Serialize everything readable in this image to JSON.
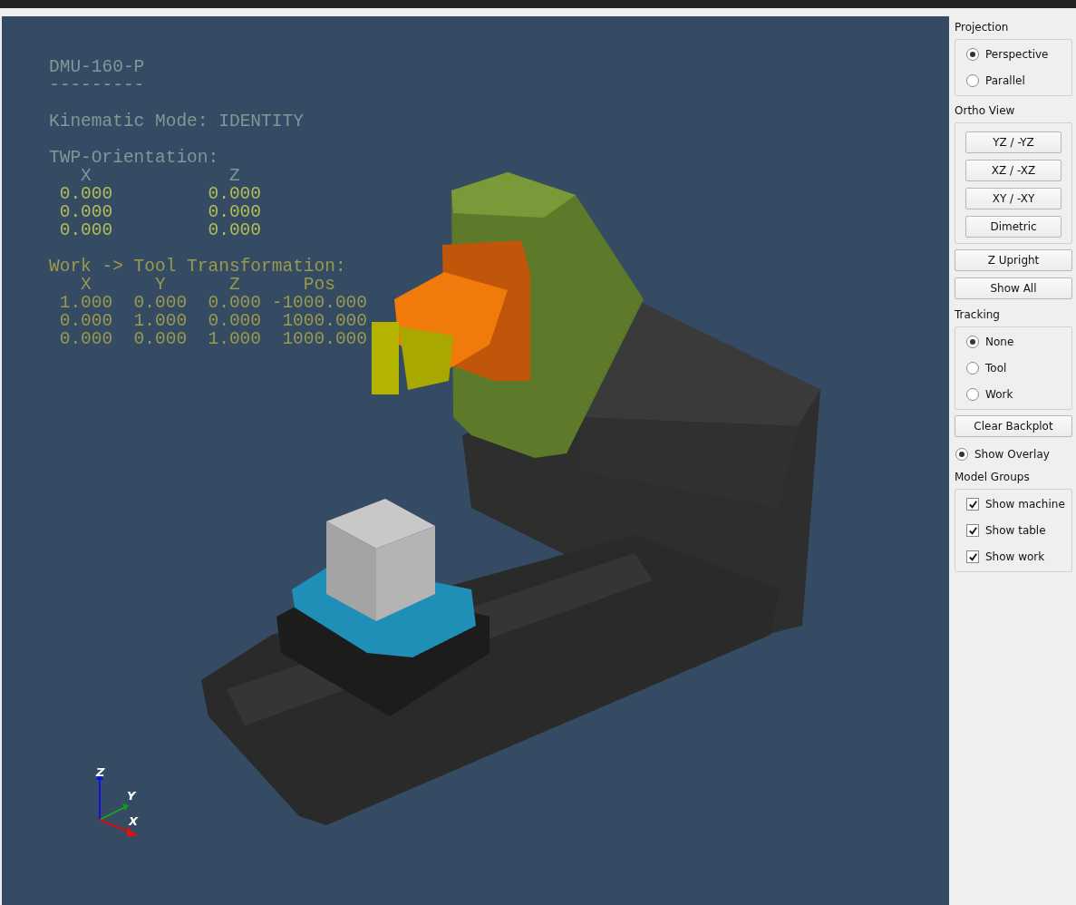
{
  "overlay": {
    "title": "DMU-160-P",
    "separator": "---------",
    "kinematic_mode": "Kinematic Mode: IDENTITY",
    "twp_orientation": {
      "heading": "TWP-Orientation:",
      "columns": [
        "X",
        "Z"
      ],
      "rows": [
        [
          "0.000",
          "0.000"
        ],
        [
          "0.000",
          "0.000"
        ],
        [
          "0.000",
          "0.000"
        ]
      ]
    },
    "transformation": {
      "heading": "Work -> Tool Transformation:",
      "columns": [
        "X",
        "Y",
        "Z",
        "Pos"
      ],
      "rows": [
        [
          "1.000",
          "0.000",
          "0.000",
          "-1000.000"
        ],
        [
          "0.000",
          "1.000",
          "0.000",
          "1000.000"
        ],
        [
          "0.000",
          "0.000",
          "1.000",
          "1000.000"
        ]
      ]
    }
  },
  "axis_labels": [
    "Z",
    "Y",
    "X"
  ],
  "panel": [
    {
      "kind": "radio-group",
      "title": "Projection",
      "options": [
        {
          "label": "Perspective",
          "selected": true
        },
        {
          "label": "Parallel",
          "selected": false
        }
      ]
    },
    {
      "kind": "button-group",
      "title": "Ortho View",
      "buttons": [
        "YZ / -YZ",
        "XZ / -XZ",
        "XY / -XY",
        "Dimetric"
      ]
    },
    {
      "kind": "button",
      "label": "Z Upright"
    },
    {
      "kind": "button",
      "label": "Show All"
    },
    {
      "kind": "radio-group",
      "title": "Tracking",
      "options": [
        {
          "label": "None",
          "selected": true
        },
        {
          "label": "Tool",
          "selected": false
        },
        {
          "label": "Work",
          "selected": false
        }
      ]
    },
    {
      "kind": "button",
      "label": "Clear Backplot"
    },
    {
      "kind": "toggle",
      "label": "Show Overlay",
      "on": true
    },
    {
      "kind": "check-group",
      "title": "Model Groups",
      "options": [
        {
          "label": "Show machine",
          "checked": true
        },
        {
          "label": "Show table",
          "checked": true
        },
        {
          "label": "Show work",
          "checked": true
        }
      ]
    }
  ]
}
